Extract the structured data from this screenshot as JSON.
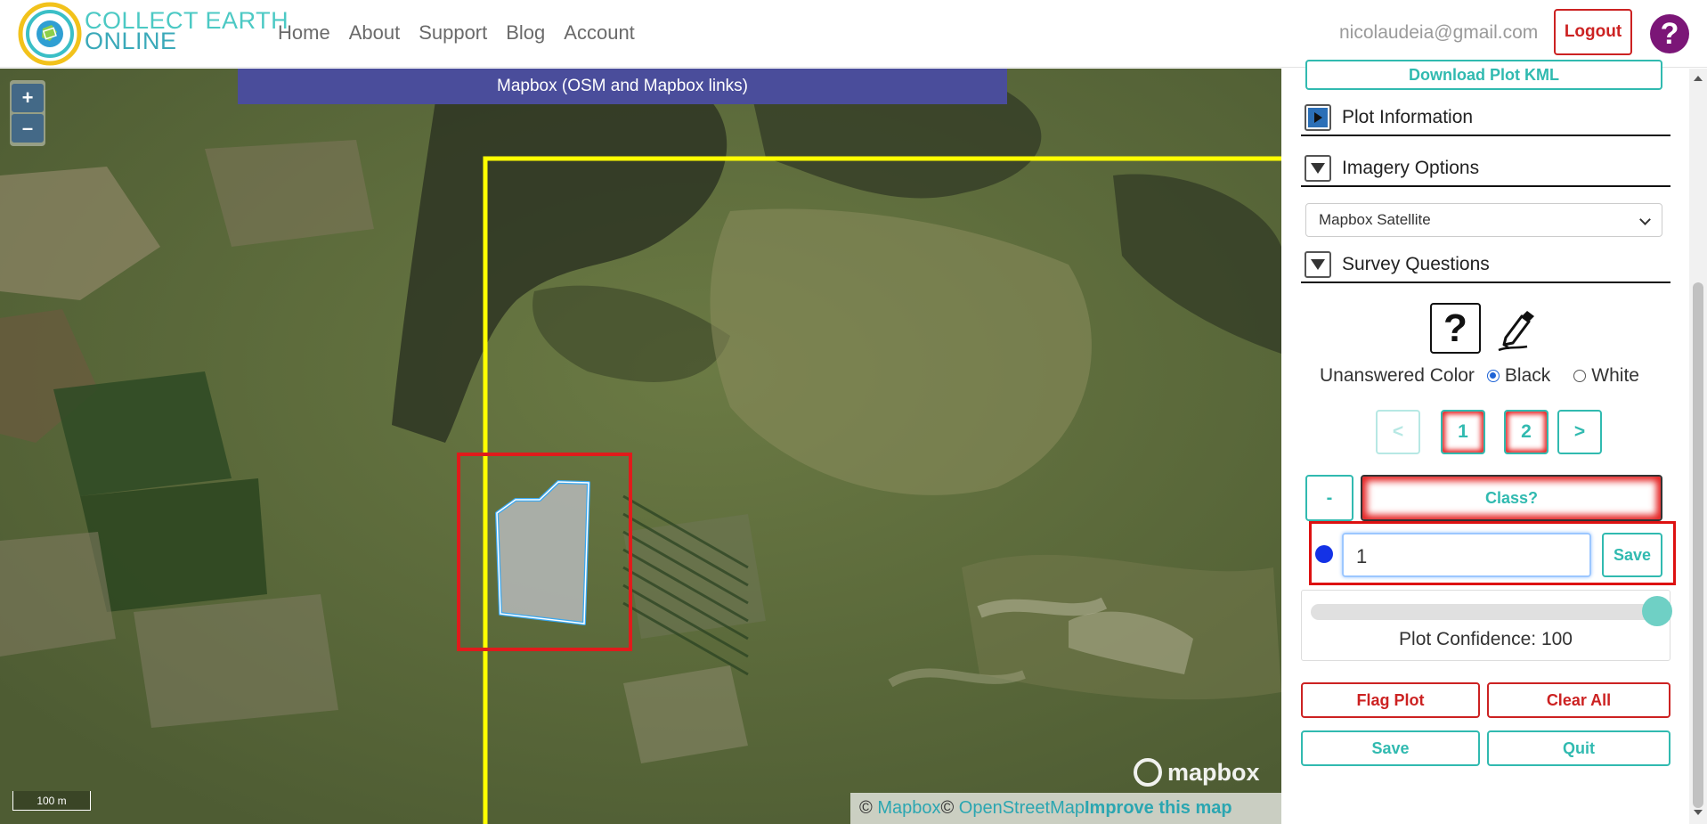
{
  "header": {
    "logo_line1": "COLLECT EARTH",
    "logo_line2": "ONLINE",
    "nav": [
      "Home",
      "About",
      "Support",
      "Blog",
      "Account"
    ],
    "email": "nicolaudeia@gmail.com",
    "logout_label": "Logout",
    "help_label": "?"
  },
  "map": {
    "imagery_banner": "Mapbox (OSM and Mapbox links)",
    "zoom_in": "+",
    "zoom_out": "–",
    "scale_label": "100 m",
    "mapbox_logo": "mapbox",
    "attribution": {
      "copyright1": "©",
      "mapbox_link": "Mapbox",
      "copyright2": "©",
      "osm_link": "OpenStreetMap",
      "improve_link": "Improve this map"
    }
  },
  "panel": {
    "download_kml_label": "Download Plot KML",
    "plot_information": "Plot Information",
    "imagery_options": "Imagery Options",
    "imagery_selected": "Mapbox Satellite",
    "survey_questions": "Survey Questions",
    "question_icon": "?",
    "unanswered_color_label": "Unanswered Color",
    "color_options": [
      "Black",
      "White"
    ],
    "color_selected": "Black",
    "pager": {
      "prev": "<",
      "pages": [
        "1",
        "2"
      ],
      "next": ">"
    },
    "minus_label": "-",
    "question_label": "Class?",
    "answer_value": "1",
    "answer_save": "Save",
    "confidence_label": "Plot Confidence: 100",
    "confidence_value": 100,
    "actions": {
      "flag": "Flag Plot",
      "clear": "Clear All",
      "save": "Save",
      "quit": "Quit"
    }
  },
  "colors": {
    "teal": "#31bab0",
    "red": "#cc2222",
    "banner": "#4a4d9b",
    "plot_boundary": "#ffff00",
    "sample_outline": "#e01b1b",
    "polygon_stroke": "#3aa8f0"
  }
}
